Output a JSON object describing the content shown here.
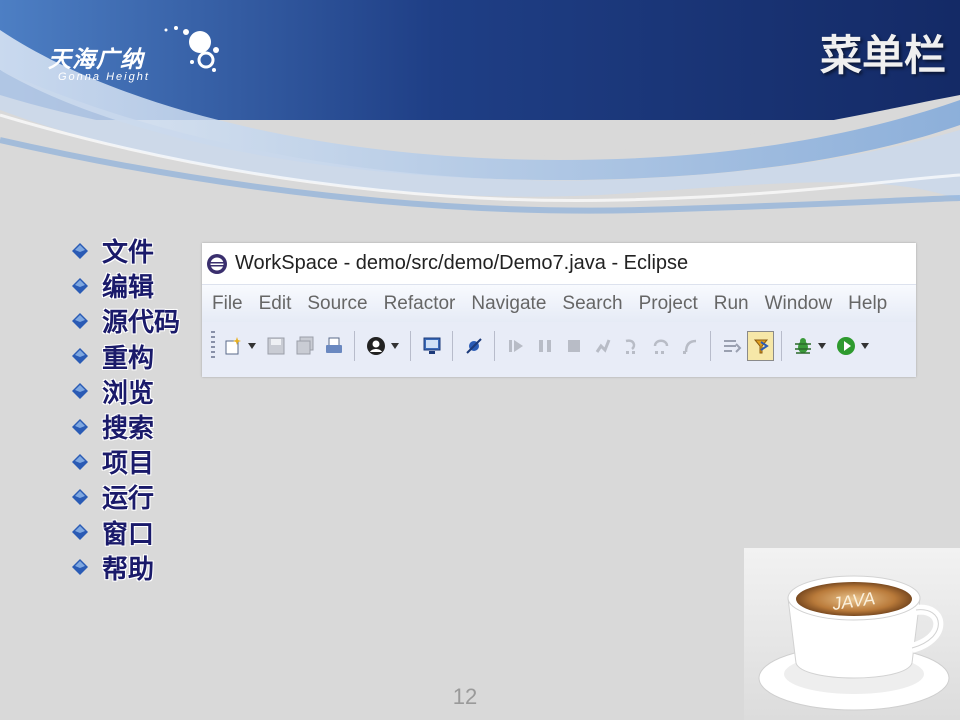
{
  "slide": {
    "title": "菜单栏",
    "page_number": "12"
  },
  "logo": {
    "name_cn": "天海广纳",
    "name_en": "Gonna Height"
  },
  "bullets": [
    "文件",
    "编辑",
    "源代码",
    "重构",
    "浏览",
    "搜索",
    "项目",
    "运行",
    "窗口",
    "帮助"
  ],
  "eclipse": {
    "window_title": "WorkSpace - demo/src/demo/Demo7.java - Eclipse",
    "menu": [
      "File",
      "Edit",
      "Source",
      "Refactor",
      "Navigate",
      "Search",
      "Project",
      "Run",
      "Window",
      "Help"
    ],
    "toolbar_icons": [
      "new-wizard-icon",
      "save-icon",
      "save-all-icon",
      "print-icon",
      "user-icon",
      "monitor-icon",
      "skip-breakpoints-icon",
      "resume-icon",
      "suspend-icon",
      "terminate-icon",
      "disconnect-icon",
      "step-into-icon",
      "step-over-icon",
      "step-return-icon",
      "drop-to-frame-icon",
      "use-step-filters-icon",
      "debug-icon",
      "run-icon"
    ]
  },
  "coffee_cup_text": "JAVA",
  "colors": {
    "header_blue": "#1c3a7a",
    "bullet_text": "#1a1a6a",
    "background": "#d9d9d9"
  }
}
